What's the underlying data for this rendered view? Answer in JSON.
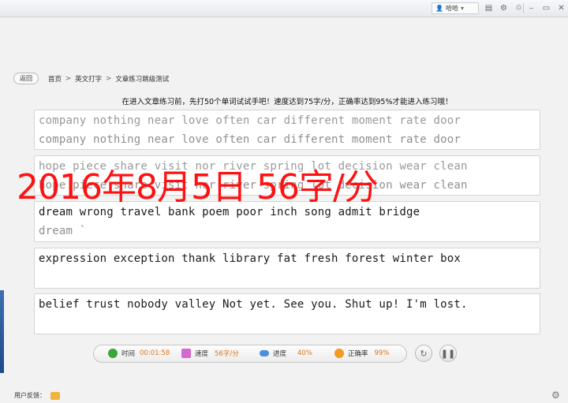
{
  "titlebar": {
    "user_name": "哈哈",
    "user_icon": "user-icon",
    "dropdown_icon": "chevron-down-icon",
    "icons": [
      "document-icon",
      "settings-icon",
      "shirt-icon",
      "minimize-icon",
      "restore-icon",
      "close-icon"
    ]
  },
  "nav": {
    "back_label": "返回",
    "breadcrumb": [
      "首页",
      "英文打字",
      "文章练习跳级测试"
    ],
    "separator": ">"
  },
  "info_text": "在进入文章练习前，先打50个单词试试手吧！速度达到75字/分，正确率达到95%才能进入练习哦！",
  "passages": [
    {
      "reference": "company nothing near love often car different moment rate door",
      "typed": "company nothing near love often car different moment rate door"
    },
    {
      "reference": "hope piece share visit nor river spring lot decision wear clean",
      "typed": "hope piece share visit nor river spring lot decision wear clean"
    },
    {
      "reference": "dream wrong travel bank poem poor inch song admit bridge",
      "typed": "dream `"
    },
    {
      "reference": "expression exception thank library fat fresh forest winter box",
      "typed": ""
    },
    {
      "reference": "belief trust nobody valley Not yet. See you. Shut up! I'm lost.",
      "typed": ""
    }
  ],
  "overlay_text": "2016年8月5日  56字/分",
  "stats": {
    "time_label": "时间",
    "time_value": "00:01:58",
    "speed_label": "速度",
    "speed_value": "56字/分",
    "progress_label": "进度",
    "progress_value": "40%",
    "accuracy_label": "正确率",
    "accuracy_value": "99%"
  },
  "controls": {
    "restart_icon": "restart-icon",
    "pause_icon": "pause-icon"
  },
  "footer": {
    "feedback_label": "用户反馈：",
    "settings_icon": "gear-icon"
  },
  "colors": {
    "overlay": "#ff1111",
    "stat_value": "#d9731b"
  }
}
